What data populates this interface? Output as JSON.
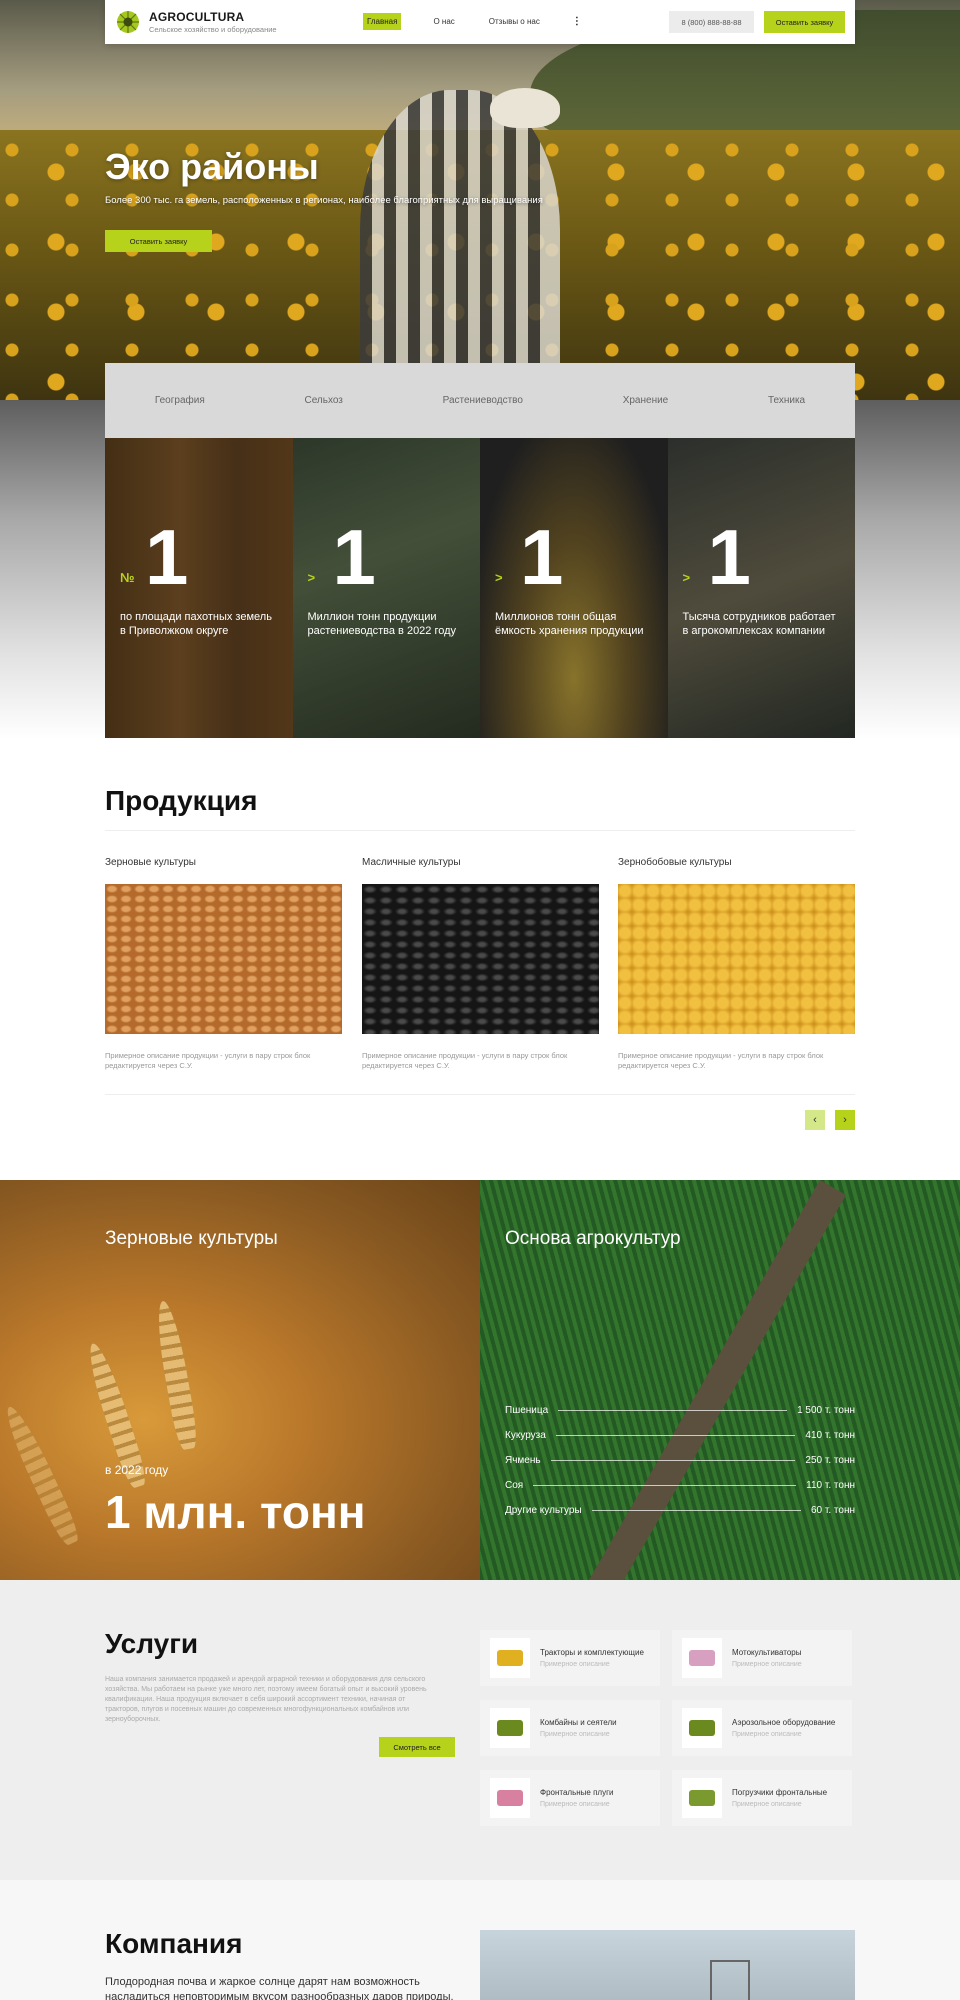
{
  "header": {
    "logo_title": "AGROCULTURA",
    "logo_subtitle": "Сельское хозяйство и оборудование",
    "nav": [
      {
        "label": "Главная",
        "active": true
      },
      {
        "label": "О нас",
        "active": false
      },
      {
        "label": "Отзывы о нас",
        "active": false
      }
    ],
    "more": "⋮",
    "phone": "8 (800) 888-88-88",
    "cta": "Оставить заявку"
  },
  "hero": {
    "title": "Эко районы",
    "subtitle": "Более 300 тыс. га земель, расположенных в регионах, наиболее благоприятных для выращивания",
    "button": "Оставить заявку"
  },
  "tabs": [
    "География",
    "Сельхоз",
    "Растениеводство",
    "Хранение",
    "Техника"
  ],
  "stats": [
    {
      "prefix": "№",
      "number": "1",
      "text": "по площади пахотных земель в Приволжком округе"
    },
    {
      "prefix": ">",
      "number": "1",
      "text": "Миллион тонн продукции растениеводства в 2022 году"
    },
    {
      "prefix": ">",
      "number": "1",
      "text": "Миллионов тонн общая ёмкость хранения продукции"
    },
    {
      "prefix": ">",
      "number": "1",
      "text": "Тысяча сотрудников работает в агрокомплексах компании"
    }
  ],
  "products": {
    "title": "Продукция",
    "items": [
      {
        "title": "Зерновые культуры",
        "desc": "Примерное описание продукции - услуги в пару строк блок редактируется через С.У."
      },
      {
        "title": "Масличные культуры",
        "desc": "Примерное описание продукции - услуги в пару строк блок редактируется через С.У."
      },
      {
        "title": "Зернобобовые культуры",
        "desc": "Примерное описание продукции - услуги в пару строк блок редактируется через С.У."
      }
    ],
    "prev": "‹",
    "next": "›"
  },
  "crops": {
    "left_title": "Зерновые культуры",
    "year": "в 2022 году",
    "big": "1 млн. тонн",
    "right_title": "Основа агрокультур",
    "rows": [
      {
        "name": "Пшеница",
        "value": "1 500 т. тонн"
      },
      {
        "name": "Кукуруза",
        "value": "410 т. тонн"
      },
      {
        "name": "Ячмень",
        "value": "250 т. тонн"
      },
      {
        "name": "Соя",
        "value": "110 т. тонн"
      },
      {
        "name": "Другие культуры",
        "value": "60 т. тонн"
      }
    ]
  },
  "services": {
    "title": "Услуги",
    "description": "Наша компания занимается продажей и арендой аграрной техники и оборудования для сельского хозяйства. Мы работаем на рынке уже много лет, поэтому имеем богатый опыт и высокий уровень квалификации. Наша продукция включает в себя широкий ассортимент техники, начиная от тракторов, плугов и посевных машин до современных многофункциональных комбайнов или зерноуборочных.",
    "button": "Смотреть все",
    "items": [
      {
        "name": "Тракторы и комплектующие",
        "sub": "Примерное описание",
        "color": "#e0b020"
      },
      {
        "name": "Мотокультиваторы",
        "sub": "Примерное описание",
        "color": "#d8a0c0"
      },
      {
        "name": "Комбайны и сеятели",
        "sub": "Примерное описание",
        "color": "#6a8a20"
      },
      {
        "name": "Аэрозольное оборудование",
        "sub": "Примерное описание",
        "color": "#6a8a20"
      },
      {
        "name": "Фронтальные плуги",
        "sub": "Примерное описание",
        "color": "#d880a0"
      },
      {
        "name": "Погрузчики фронтальные",
        "sub": "Примерное описание",
        "color": "#7a9a30"
      }
    ]
  },
  "company": {
    "title": "Компания",
    "text": "Плодородная почва и жаркое солнце дарят нам возможность насладиться неповторимым вкусом разнообразных даров природы."
  }
}
